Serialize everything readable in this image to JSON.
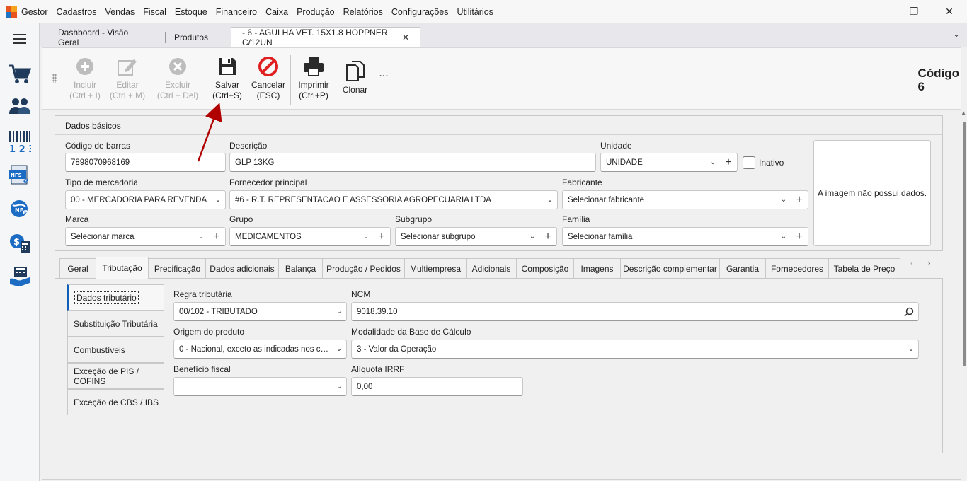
{
  "app": {
    "name": "Gestor"
  },
  "menu": [
    "Cadastros",
    "Vendas",
    "Fiscal",
    "Estoque",
    "Financeiro",
    "Caixa",
    "Produção",
    "Relatórios",
    "Configurações",
    "Utilitários"
  ],
  "window_controls": {
    "minimize": "—",
    "restore": "❐",
    "close": "✕"
  },
  "doc_tabs": [
    {
      "label": "Dashboard - Visão Geral"
    },
    {
      "label": "Produtos"
    },
    {
      "label": "- 6 - AGULHA VET. 15X1.8 HOPPNER C/12UN"
    }
  ],
  "toolbar": {
    "incluir": [
      "Incluir",
      "(Ctrl + I)"
    ],
    "editar": [
      "Editar",
      "(Ctrl + M)"
    ],
    "excluir": [
      "Excluir",
      "(Ctrl + Del)"
    ],
    "salvar": [
      "Salvar",
      "(Ctrl+S)"
    ],
    "cancelar": [
      "Cancelar",
      "(ESC)"
    ],
    "imprimir": [
      "Imprimir",
      "(Ctrl+P)"
    ],
    "clonar": "Clonar",
    "more": "...",
    "codigo_label": "Código",
    "codigo_value": "6"
  },
  "dados_basicos": {
    "title": "Dados básicos",
    "codigo_barras": {
      "label": "Código de barras",
      "value": "7898070968169"
    },
    "descricao": {
      "label": "Descrição",
      "value": "GLP 13KG"
    },
    "unidade": {
      "label": "Unidade",
      "value": "UNIDADE"
    },
    "inativo": {
      "label": "Inativo",
      "checked": false
    },
    "tipo_mercadoria": {
      "label": "Tipo de mercadoria",
      "value": "00 - MERCADORIA PARA REVENDA"
    },
    "fornecedor": {
      "label": "Fornecedor principal",
      "value": "#6 - R.T. REPRESENTACAO E ASSESSORIA AGROPECUARIA LTDA"
    },
    "fabricante": {
      "label": "Fabricante",
      "value": "Selecionar fabricante"
    },
    "marca": {
      "label": "Marca",
      "value": "Selecionar marca"
    },
    "grupo": {
      "label": "Grupo",
      "value": "MEDICAMENTOS"
    },
    "subgrupo": {
      "label": "Subgrupo",
      "value": "Selecionar subgrupo"
    },
    "familia": {
      "label": "Família",
      "value": "Selecionar família"
    },
    "imagem": "A imagem não possui dados."
  },
  "tabs": [
    "Geral",
    "Tributação",
    "Precificação",
    "Dados adicionais",
    "Balança",
    "Produção / Pedidos",
    "Multiempresa",
    "Adicionais",
    "Composição",
    "Imagens",
    "Descrição complementar",
    "Garantia",
    "Fornecedores",
    "Tabela de Preço"
  ],
  "active_tab": "Tributação",
  "tab_nav": {
    "prev": "‹",
    "next": "›"
  },
  "sub_tabs": [
    "Dados tributário",
    "Substituição Tributária",
    "Combustíveis",
    "Exceção de PIS / COFINS",
    "Exceção de CBS / IBS"
  ],
  "tributacao": {
    "regra": {
      "label": "Regra tributária",
      "value": "00/102 - TRIBUTADO"
    },
    "ncm": {
      "label": "NCM",
      "value": "9018.39.10"
    },
    "origem": {
      "label": "Origem do produto",
      "value": "0 - Nacional, exceto as indicadas nos códi..."
    },
    "modalidade": {
      "label": "Modalidade da Base de Cálculo",
      "value": "3 - Valor da Operação"
    },
    "beneficio": {
      "label": "Benefício fiscal",
      "value": ""
    },
    "aliquota_irrf": {
      "label": "Alíquota IRRF",
      "value": "0,00"
    }
  },
  "icons": {
    "hamburger": "menu-icon",
    "cart": "cart-icon",
    "people": "people-icon",
    "barcode": "barcode-icon",
    "nfse": "nfse-icon",
    "nfe": "nfe-icon",
    "finance": "finance-icon",
    "cash": "cash-register-icon"
  },
  "colors": {
    "accent": "#0f5fb6",
    "cancel_red": "#e02020",
    "annotation_arrow": "#b00000",
    "disabled": "#a9a9a9"
  }
}
